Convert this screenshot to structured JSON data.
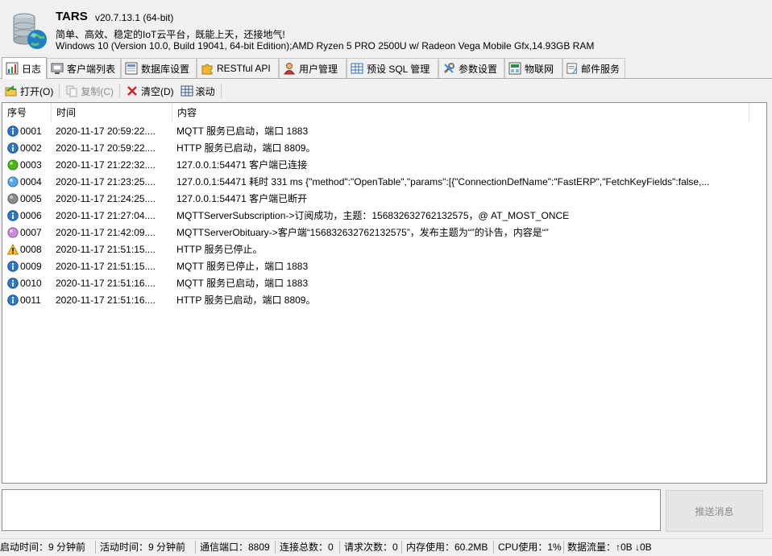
{
  "app": {
    "title": "TARS",
    "version": "v20.7.13.1 (64-bit)",
    "slogan": "简单、高效、稳定的IoT云平台，既能上天，还接地气!",
    "sysinfo": "Windows 10 (Version 10.0, Build 19041, 64-bit Edition);AMD Ryzen 5 PRO 2500U w/ Radeon Vega Mobile Gfx,14.93GB RAM"
  },
  "tabs": [
    {
      "label": "日志",
      "icon": "chart-icon",
      "active": true
    },
    {
      "label": "客户端列表",
      "icon": "monitor-icon"
    },
    {
      "label": "数据库设置",
      "icon": "database-icon"
    },
    {
      "label": "RESTful API",
      "icon": "puzzle-icon"
    },
    {
      "label": "用户管理",
      "icon": "user-icon"
    },
    {
      "label": "预设 SQL 管理",
      "icon": "table-icon"
    },
    {
      "label": "参数设置",
      "icon": "tools-icon"
    },
    {
      "label": "物联网",
      "icon": "iot-icon"
    },
    {
      "label": "邮件服务",
      "icon": "mail-icon"
    }
  ],
  "toolbar": {
    "open": "打开(O)",
    "copy": "复制(C)",
    "clear": "清空(D)",
    "scroll": "滚动"
  },
  "list": {
    "columns": [
      "序号",
      "时间",
      "内容"
    ],
    "rows": [
      {
        "id": "0001",
        "time": "2020-11-17 20:59:22....",
        "content": "MQTT 服务已启动，端口 1883",
        "icon": "info-icon"
      },
      {
        "id": "0002",
        "time": "2020-11-17 20:59:22....",
        "content": "HTTP 服务已启动，端口 8809。",
        "icon": "info-icon"
      },
      {
        "id": "0003",
        "time": "2020-11-17 21:22:32....",
        "content": "127.0.0.1:54471 客户端已连接",
        "icon": "green-dot-icon"
      },
      {
        "id": "0004",
        "time": "2020-11-17 21:23:25....",
        "content": "127.0.0.1:54471 耗时 331 ms {\"method\":\"OpenTable\",\"params\":[{\"ConnectionDefName\":\"FastERP\",\"FetchKeyFields\":false,...",
        "icon": "blue-dot-icon"
      },
      {
        "id": "0005",
        "time": "2020-11-17 21:24:25....",
        "content": "127.0.0.1:54471 客户端已断开",
        "icon": "gray-dot-icon"
      },
      {
        "id": "0006",
        "time": "2020-11-17 21:27:04....",
        "content": "MQTTServerSubscription->订阅成功，主题：156832632762132575，@ AT_MOST_ONCE",
        "icon": "info-icon"
      },
      {
        "id": "0007",
        "time": "2020-11-17 21:42:09....",
        "content": "MQTTServerObituary->客户端“156832632762132575”，发布主题为“”的讣告，内容是“”",
        "icon": "purple-dot-icon"
      },
      {
        "id": "0008",
        "time": "2020-11-17 21:51:15....",
        "content": "HTTP 服务已停止。",
        "icon": "warning-icon"
      },
      {
        "id": "0009",
        "time": "2020-11-17 21:51:15....",
        "content": "MQTT 服务已停止，端口 1883",
        "icon": "info-icon"
      },
      {
        "id": "0010",
        "time": "2020-11-17 21:51:16....",
        "content": "MQTT 服务已启动，端口 1883",
        "icon": "info-icon"
      },
      {
        "id": "0011",
        "time": "2020-11-17 21:51:16....",
        "content": "HTTP 服务已启动，端口 8809。",
        "icon": "info-icon"
      }
    ]
  },
  "message": {
    "input_value": "",
    "send_label": "推送消息"
  },
  "status": [
    "启动时间：9 分钟前",
    "活动时间：9 分钟前",
    "通信端口：8809",
    "连接总数：0",
    "请求次数：0",
    "内存使用：60.2MB",
    "CPU使用：1%",
    "数据流量：↑0B  ↓0B"
  ]
}
